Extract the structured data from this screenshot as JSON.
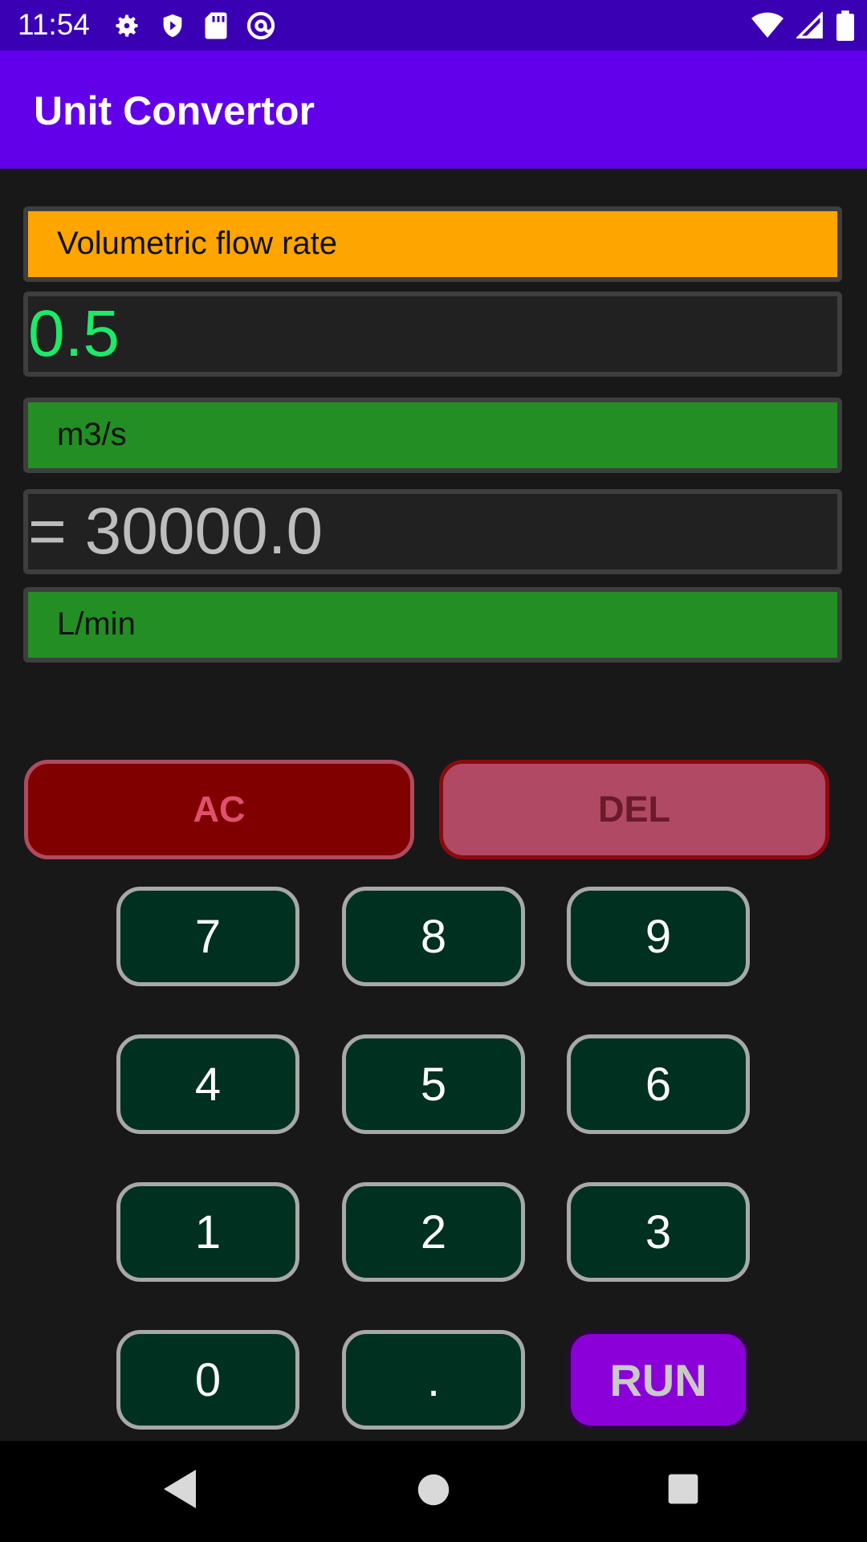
{
  "status_bar": {
    "time": "11:54",
    "left_icons": [
      "gear-icon",
      "shield-icon",
      "sd-card-icon",
      "at-sign-icon"
    ],
    "right_icons": [
      "wifi-icon",
      "signal-icon",
      "battery-icon"
    ]
  },
  "app_bar": {
    "title": "Unit Convertor"
  },
  "converter": {
    "category": "Volumetric flow rate",
    "input_value": "0.5",
    "from_unit": "m3/s",
    "result": "= 30000.0",
    "to_unit": "L/min"
  },
  "buttons": {
    "clear": "AC",
    "delete": "DEL",
    "keys": [
      "7",
      "8",
      "9",
      "4",
      "5",
      "6",
      "1",
      "2",
      "3",
      "0",
      "."
    ],
    "run": "RUN"
  },
  "nav_bar": {
    "icons": [
      "back-icon",
      "home-icon",
      "recents-icon"
    ]
  },
  "colors": {
    "status_bar": "#3a00b4",
    "app_bar": "#6200ea",
    "category": "#ffa500",
    "unit_field": "#238e23",
    "input_text": "#1de96a",
    "key_bg": "#003020",
    "run_bg": "#8b00d8",
    "ac_bg": "#800000",
    "del_bg": "#b04a64"
  }
}
